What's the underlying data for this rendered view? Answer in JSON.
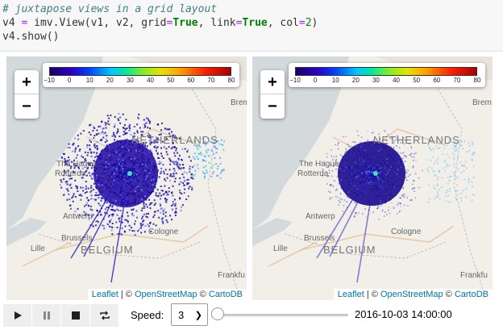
{
  "code_cell": {
    "comment": "# juxtapose views in a grid layout",
    "line2_a": "v4 ",
    "line2_eq": "=",
    "line2_b": " imv.View(v1, v2, grid",
    "line2_eq2": "=",
    "line2_true1": "True",
    "line2_c": ", link",
    "line2_eq3": "=",
    "line2_true2": "True",
    "line2_d": ", col",
    "line2_eq4": "=",
    "line2_num": "2",
    "line2_e": ")",
    "line3": "v4.show()"
  },
  "colorbar": {
    "ticks": [
      "−10",
      "0",
      "10",
      "20",
      "30",
      "40",
      "50",
      "60",
      "70",
      "80"
    ],
    "min": -10,
    "max": 80
  },
  "zoom": {
    "in_label": "+",
    "out_label": "−"
  },
  "attribution": {
    "leaflet": "Leaflet",
    "sep1": " | © ",
    "osm": "OpenStreetMap",
    "sep2": " © ",
    "carto": "CartoDB"
  },
  "map_labels": {
    "netherlands": "NETHERLANDS",
    "the_hague": "The Hague",
    "rotterdam": "Rotterda",
    "antwerp": "Antwerp",
    "brussels": "Brussels",
    "belgium": "BELGIUM",
    "cologne": "Cologne",
    "lille": "Lille",
    "frankfurt": "Frankfu",
    "bremen": "Brem"
  },
  "controls": {
    "speed_label": "Speed:",
    "speed_value": "3",
    "timestamp": "2016-10-03 14:00:00",
    "slider_fraction": 0
  },
  "colors": {
    "land": "#f2efe9",
    "water": "#d4dadc",
    "radar_dark": "#1a0a8c",
    "radar_mid": "#2233dd"
  }
}
